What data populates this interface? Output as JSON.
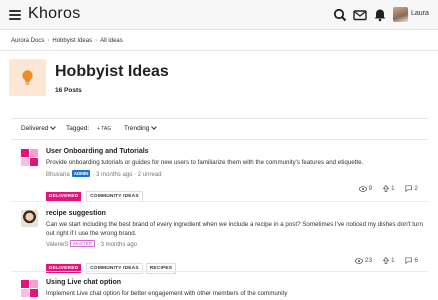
{
  "header": {
    "brand": "Khoros",
    "user_name": "Laura"
  },
  "breadcrumb": [
    "Aurora Docs",
    "Hobbyist Ideas",
    "All ideas"
  ],
  "board": {
    "title": "Hobbyist Ideas",
    "post_count": "16 Posts"
  },
  "filters": {
    "status": "Delivered",
    "tagged_label": "Tagged:",
    "tag_button": "+ TAG",
    "sort": "Trending"
  },
  "ideas": [
    {
      "title": "User Onboarding and Tutorials",
      "body": "Provide onboarding tutorials or guides for new users to familiarize them with the community's features and etiquette.",
      "author": "Bhuvana",
      "role": "ADMIN",
      "time": "· 3 months ago · 2 unread",
      "status": "DELIVERED",
      "tags": [
        "COMMUNITY IDEAS"
      ],
      "views": "9",
      "kudos": "1",
      "replies": "2"
    },
    {
      "title": "recipe suggestion",
      "body": "Can we start including the best brand of every ingredient when we include a recipe in a post? Sometimes I've noticed my dishes don't turn out right if I use the wrong brand.",
      "author": "ValerieS",
      "role": "MASTER",
      "time": "· 3 months ago",
      "status": "DELIVERED",
      "tags": [
        "COMMUNITY IDEAS",
        "RECIPES"
      ],
      "views": "23",
      "kudos": "1",
      "replies": "6"
    },
    {
      "title": "Using Live chat option",
      "body": "Implement Live chat option for better engagement with other members of the community"
    }
  ],
  "colors": {
    "accent": "#e3127c",
    "admin": "#1a73d9",
    "bulb": "#f08a24"
  }
}
